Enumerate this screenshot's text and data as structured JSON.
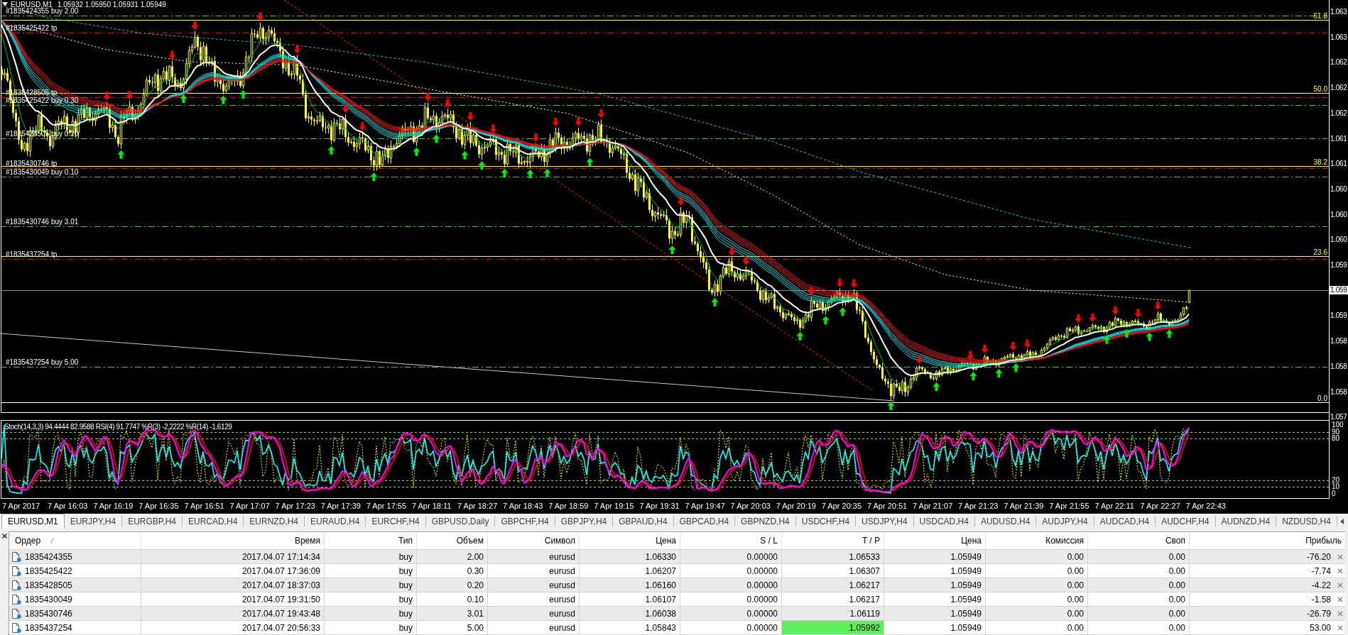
{
  "chart": {
    "symbol": "EURUSD,M1",
    "ohlc": "1.05932 1.05950 1.05931 1.05949",
    "order_lines": [
      {
        "label": "#1835424355 buy 2.00",
        "kind": "open"
      },
      {
        "label": "#1835425422 tp",
        "kind": "tp"
      },
      {
        "label": "#1835428505 tp",
        "kind": "tp"
      },
      {
        "label": "#1835425422 buy 0.30",
        "kind": "open"
      },
      {
        "label": "#1835428505 buy 0.20",
        "kind": "open"
      },
      {
        "label": "#1835430746 tp",
        "kind": "tp"
      },
      {
        "label": "#1835430049 buy 0.10",
        "kind": "open"
      },
      {
        "label": "#1835430746 buy 3.01",
        "kind": "open"
      },
      {
        "label": "#1835437254 tp",
        "kind": "tp"
      },
      {
        "label": "#1835437254 buy 5.00",
        "kind": "open"
      }
    ],
    "fibo_levels": [
      {
        "label": "61.8",
        "color": "#ffff00"
      },
      {
        "label": "50.0",
        "color": "#ffff00"
      },
      {
        "label": "38.2",
        "color": "#ffff00"
      },
      {
        "label": "23.6",
        "color": "#ffff00"
      },
      {
        "label": "0.0",
        "color": "#ffffff"
      }
    ],
    "price_axis": [
      "1.063",
      "1.063",
      "1.062",
      "1.062",
      "1.062",
      "1.061",
      "1.061",
      "1.060",
      "1.060",
      "1.060",
      "1.059",
      "1.059",
      "1.058",
      "1.058",
      "1.058",
      "1.057"
    ],
    "current_price": "1.059"
  },
  "indicator": {
    "legend": "Stoch(14,3,3) 94.4444 82.9588 RSI(4) 91.7747 %R(3) -2.2222 %R(14) -1.6129",
    "axis": [
      "100",
      "90",
      "80",
      "20",
      "10",
      "0"
    ]
  },
  "time_axis": [
    "7 Apr 2017",
    "7 Apr 16:03",
    "7 Apr 16:19",
    "7 Apr 16:35",
    "7 Apr 16:51",
    "7 Apr 17:07",
    "7 Apr 17:23",
    "7 Apr 17:39",
    "7 Apr 17:55",
    "7 Apr 18:11",
    "7 Apr 18:27",
    "7 Apr 18:43",
    "7 Apr 18:59",
    "7 Apr 19:15",
    "7 Apr 19:31",
    "7 Apr 19:47",
    "7 Apr 20:03",
    "7 Apr 20:19",
    "7 Apr 20:35",
    "7 Apr 20:51",
    "7 Apr 21:07",
    "7 Apr 21:23",
    "7 Apr 21:39",
    "7 Apr 21:55",
    "7 Apr 22:11",
    "7 Apr 22:27",
    "7 Apr 22:43"
  ],
  "tabs": [
    {
      "label": "EURUSD,M1",
      "selected": true
    },
    {
      "label": "EURJPY,H4",
      "selected": false
    },
    {
      "label": "EURGBP,H4",
      "selected": false
    },
    {
      "label": "EURCAD,H4",
      "selected": false
    },
    {
      "label": "EURNZD,H4",
      "selected": false
    },
    {
      "label": "EURAUD,H4",
      "selected": false
    },
    {
      "label": "EURCHF,H4",
      "selected": false
    },
    {
      "label": "GBPUSD,Daily",
      "selected": false
    },
    {
      "label": "GBPCHF,H4",
      "selected": false
    },
    {
      "label": "GBPJPY,H4",
      "selected": false
    },
    {
      "label": "GBPAUD,H4",
      "selected": false
    },
    {
      "label": "GBPCAD,H4",
      "selected": false
    },
    {
      "label": "GBPNZD,H4",
      "selected": false
    },
    {
      "label": "USDCHF,H4",
      "selected": false
    },
    {
      "label": "USDJPY,H4",
      "selected": false
    },
    {
      "label": "USDCAD,H4",
      "selected": false
    },
    {
      "label": "AUDUSD,H4",
      "selected": false
    },
    {
      "label": "AUDJPY,H4",
      "selected": false
    },
    {
      "label": "AUDCAD,H4",
      "selected": false
    },
    {
      "label": "AUDCHF,H4",
      "selected": false
    },
    {
      "label": "AUDNZD,H4",
      "selected": false
    },
    {
      "label": "NZDUSD,H4",
      "selected": false
    }
  ],
  "orders": {
    "columns": [
      {
        "label": "Ордер",
        "sorted": true
      },
      {
        "label": "Время",
        "sorted": false
      },
      {
        "label": "Тип",
        "sorted": false
      },
      {
        "label": "Объем",
        "sorted": false
      },
      {
        "label": "Символ",
        "sorted": false
      },
      {
        "label": "Цена",
        "sorted": false
      },
      {
        "label": "S / L",
        "sorted": false
      },
      {
        "label": "T / P",
        "sorted": false
      },
      {
        "label": "Цена",
        "sorted": false
      },
      {
        "label": "Комиссия",
        "sorted": false
      },
      {
        "label": "Своп",
        "sorted": false
      },
      {
        "label": "Прибыль",
        "sorted": false
      }
    ],
    "rows": [
      {
        "cells": [
          "1835424355",
          "2017.04.07 17:14:34",
          "buy",
          "2.00",
          "eurusd",
          "1.06330",
          "0.00000",
          "1.06533",
          "1.05949",
          "0.00",
          "0.00",
          "-76.20"
        ],
        "tp_highlighted": false
      },
      {
        "cells": [
          "1835425422",
          "2017.04.07 17:36:09",
          "buy",
          "0.30",
          "eurusd",
          "1.06207",
          "0.00000",
          "1.06307",
          "1.05949",
          "0.00",
          "0.00",
          "-7.74"
        ],
        "tp_highlighted": false
      },
      {
        "cells": [
          "1835428505",
          "2017.04.07 18:37:03",
          "buy",
          "0.20",
          "eurusd",
          "1.06160",
          "0.00000",
          "1.06217",
          "1.05949",
          "0.00",
          "0.00",
          "-4.22"
        ],
        "tp_highlighted": false
      },
      {
        "cells": [
          "1835430049",
          "2017.04.07 19:31:50",
          "buy",
          "0.10",
          "eurusd",
          "1.06107",
          "0.00000",
          "1.06217",
          "1.05949",
          "0.00",
          "0.00",
          "-1.58"
        ],
        "tp_highlighted": false
      },
      {
        "cells": [
          "1835430746",
          "2017.04.07 19:43:48",
          "buy",
          "3.01",
          "eurusd",
          "1.06038",
          "0.00000",
          "1.06119",
          "1.05949",
          "0.00",
          "0.00",
          "-26.79"
        ],
        "tp_highlighted": false
      },
      {
        "cells": [
          "1835437254",
          "2017.04.07 20:56:33",
          "buy",
          "5.00",
          "eurusd",
          "1.05843",
          "0.00000",
          "1.05992",
          "1.05949",
          "0.00",
          "0.00",
          "53.00"
        ],
        "tp_highlighted": true
      }
    ]
  }
}
